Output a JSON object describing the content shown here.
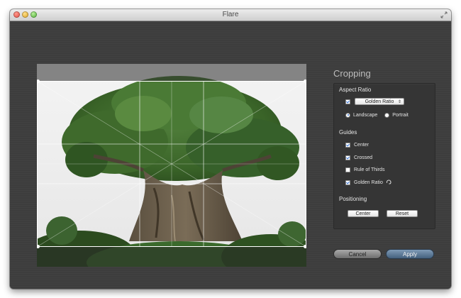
{
  "window": {
    "title": "Flare"
  },
  "panel": {
    "title": "Cropping",
    "aspect_ratio": {
      "heading": "Aspect Ratio",
      "enabled": true,
      "selected": "Golden Ratio",
      "orientation": {
        "options": [
          "Landscape",
          "Portrait"
        ],
        "selected": "Landscape"
      }
    },
    "guides": {
      "heading": "Guides",
      "items": [
        {
          "label": "Center",
          "checked": true
        },
        {
          "label": "Crossed",
          "checked": true
        },
        {
          "label": "Rule of Thirds",
          "checked": false
        },
        {
          "label": "Golden Ratio",
          "checked": true
        }
      ]
    },
    "positioning": {
      "heading": "Positioning",
      "center_label": "Center",
      "reset_label": "Reset"
    }
  },
  "actions": {
    "cancel_label": "Cancel",
    "apply_label": "Apply"
  },
  "colors": {
    "accent": "#2f6fd6",
    "apply_button": "#5b7895",
    "window_bg": "#3d3d3d"
  }
}
